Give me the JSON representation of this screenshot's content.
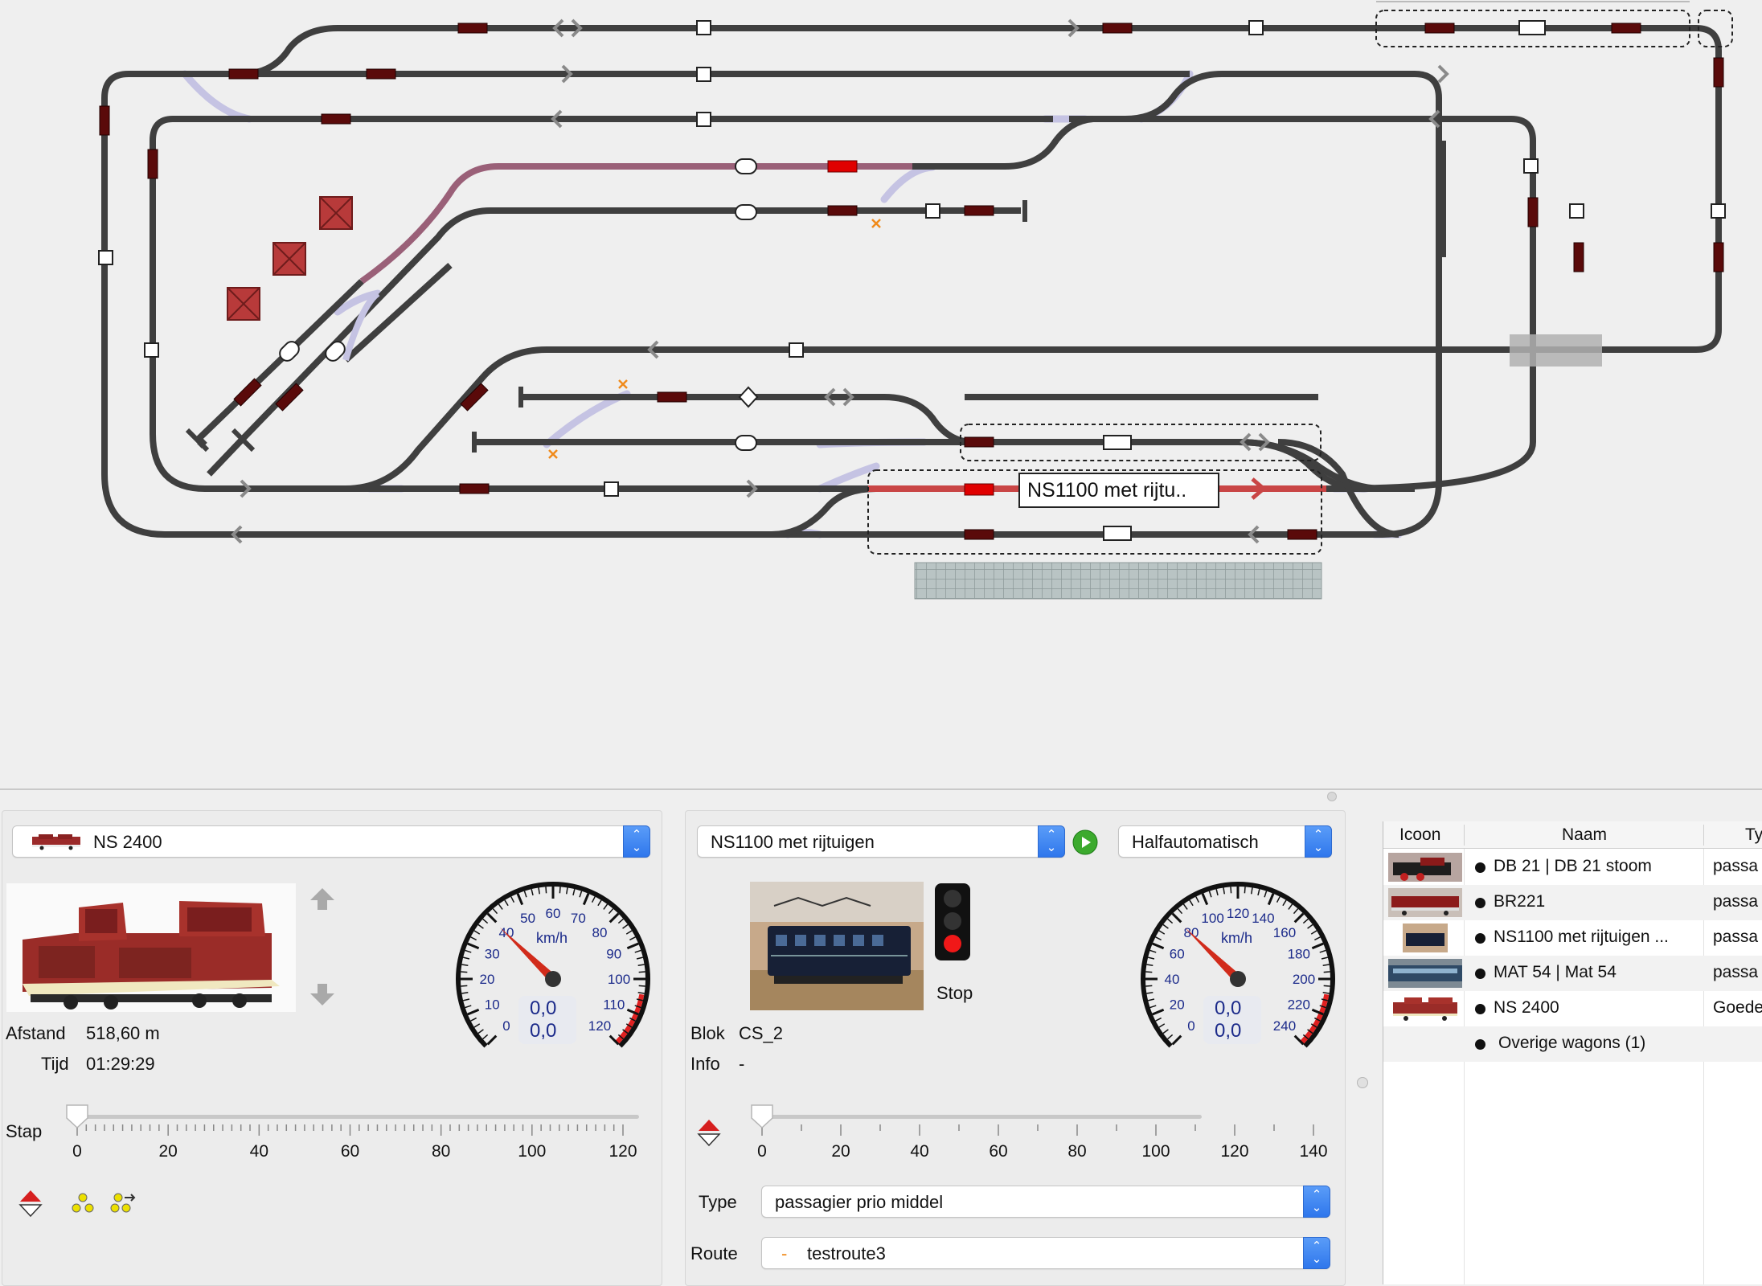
{
  "layout_view": {
    "train_label": "NS1100 met rijtu.."
  },
  "left_panel": {
    "loco_select": "NS 2400",
    "distance_label": "Afstand",
    "distance_value": "518,60 m",
    "time_label": "Tijd",
    "time_value": "01:29:29",
    "speed_display_1": "0,0",
    "speed_display_2": "0,0",
    "speed_unit": "km/h",
    "gauge_ticks": [
      "0",
      "10",
      "20",
      "30",
      "40",
      "50",
      "60",
      "70",
      "80",
      "90",
      "100",
      "110",
      "120"
    ],
    "step_label": "Stap",
    "slider_value": 0,
    "slider_ticks": [
      "0",
      "20",
      "40",
      "60",
      "80",
      "100",
      "120"
    ]
  },
  "middle_panel": {
    "train_select": "NS1100 met rijtuigen",
    "mode_select": "Halfautomatisch",
    "signal_label": "Stop",
    "block_label": "Blok",
    "block_value": "CS_2",
    "info_label": "Info",
    "info_value": "-",
    "speed_display_1": "0,0",
    "speed_display_2": "0,0",
    "speed_unit": "km/h",
    "gauge_ticks": [
      "0",
      "20",
      "40",
      "60",
      "80",
      "100",
      "120",
      "140",
      "160",
      "180",
      "200",
      "220",
      "240"
    ],
    "slider_value": 0,
    "slider_ticks": [
      "0",
      "20",
      "40",
      "60",
      "80",
      "100",
      "120",
      "140"
    ],
    "type_label": "Type",
    "type_value": "passagier prio middel",
    "route_label": "Route",
    "route_value": "testroute3",
    "route_prefix": "-"
  },
  "right_panel": {
    "columns": [
      "Icoon",
      "Naam",
      "Ty"
    ],
    "rows": [
      {
        "name": "DB 21  | DB 21 stoom",
        "type": "passa"
      },
      {
        "name": "BR221",
        "type": "passa"
      },
      {
        "name": "NS1100 met rijtuigen ...",
        "type": "passa"
      },
      {
        "name": "MAT 54 | Mat 54",
        "type": "passa"
      },
      {
        "name": "NS 2400",
        "type": "Goede"
      },
      {
        "name": "Overige wagons (1)",
        "type": ""
      }
    ]
  },
  "colors": {
    "track": "#3f3f3f",
    "occupied_route": "#c94545",
    "reserved_route": "#9a6078",
    "switch_light": "#c5c3e3",
    "block_marker": "#5a0a0a",
    "active_marker": "#e00000",
    "accent_blue": "#2f77ec"
  }
}
